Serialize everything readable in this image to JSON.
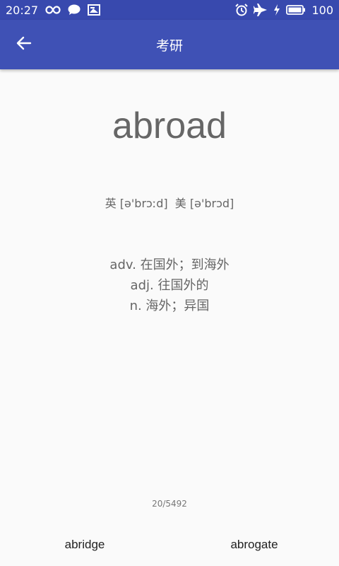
{
  "status_bar": {
    "time": "20:27",
    "battery": "100",
    "left_icons": [
      "infinity-icon",
      "chat-bubble-icon",
      "image-icon"
    ],
    "right_icons": [
      "alarm-icon",
      "airplane-icon",
      "charging-icon",
      "battery-icon"
    ]
  },
  "app_bar": {
    "title": "考研",
    "back_icon": "arrow-left-icon"
  },
  "word": {
    "text": "abroad",
    "phonetics": "英 [ə'brɔːd]  美 [ə'brɔd]",
    "definitions": [
      "adv. 在国外；到海外",
      "adj. 往国外的",
      "n. 海外；异国"
    ]
  },
  "progress": "20/5492",
  "navigation": {
    "previous": "abridge",
    "next": "abrogate"
  },
  "colors": {
    "status_bar": "#3849ae",
    "app_bar": "#3f51b5",
    "background": "#fafafa",
    "word_text": "#666666"
  }
}
